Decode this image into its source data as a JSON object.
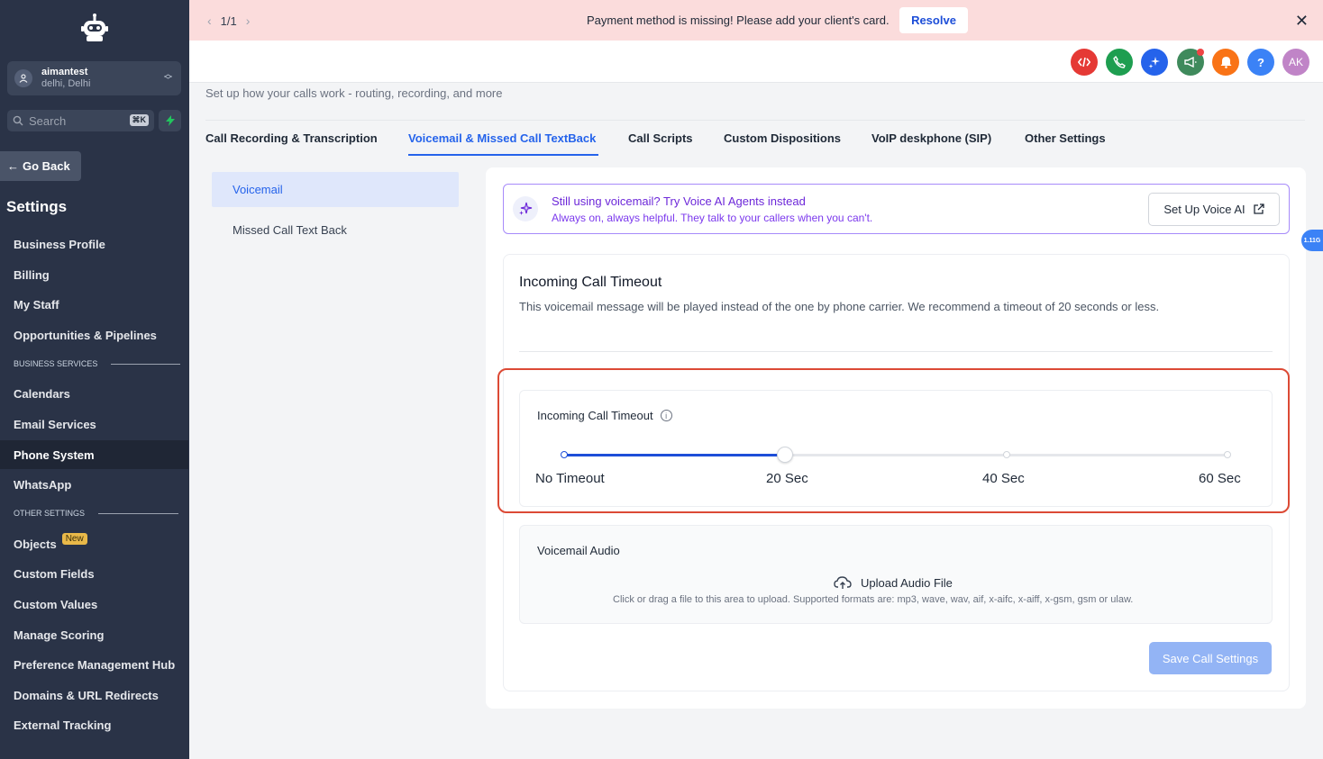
{
  "sidebar": {
    "account": {
      "name": "aimantest",
      "location": "delhi, Delhi"
    },
    "search": {
      "placeholder": "Search",
      "shortcut": "⌘K"
    },
    "go_back": "Go Back",
    "title": "Settings",
    "items": [
      {
        "label": "Business Profile"
      },
      {
        "label": "Billing"
      },
      {
        "label": "My Staff"
      },
      {
        "label": "Opportunities & Pipelines"
      },
      {
        "label": "Calendars"
      },
      {
        "label": "Email Services"
      },
      {
        "label": "Phone System",
        "active": true
      },
      {
        "label": "WhatsApp"
      },
      {
        "label": "Objects",
        "badge": "New"
      },
      {
        "label": "Custom Fields"
      },
      {
        "label": "Custom Values"
      },
      {
        "label": "Manage Scoring"
      },
      {
        "label": "Preference Management Hub"
      },
      {
        "label": "Domains & URL Redirects"
      },
      {
        "label": "External Tracking"
      }
    ],
    "sections": {
      "business": "BUSINESS SERVICES",
      "other": "OTHER SETTINGS"
    }
  },
  "banner": {
    "pager": "1/1",
    "message": "Payment method is missing! Please add your client's card.",
    "resolve": "Resolve"
  },
  "header": {
    "avatar_initials": "AK",
    "icons": [
      "code-icon",
      "phone-icon",
      "sparkle-icon",
      "megaphone-icon",
      "bell-icon",
      "help-icon"
    ],
    "colors": {
      "code": "#e53935",
      "phone": "#1e9e50",
      "sparkle": "#2563eb",
      "megaphone": "#3f8a5c",
      "bell": "#f97316",
      "help": "#3b82f6",
      "avatar": "#c084c7"
    }
  },
  "page": {
    "subtitle": "Set up how your calls work - routing, recording, and more",
    "tabs": [
      {
        "label": "Call Recording & Transcription"
      },
      {
        "label": "Voicemail & Missed Call TextBack",
        "active": true
      },
      {
        "label": "Call Scripts"
      },
      {
        "label": "Custom Dispositions"
      },
      {
        "label": "VoIP deskphone (SIP)"
      },
      {
        "label": "Other Settings"
      }
    ],
    "subnav": [
      {
        "label": "Voicemail",
        "active": true
      },
      {
        "label": "Missed Call Text Back"
      }
    ]
  },
  "promo": {
    "title": "Still using voicemail? Try Voice AI Agents instead",
    "subtitle": "Always on, always helpful. They talk to your callers when you can't.",
    "button": "Set Up Voice AI"
  },
  "version": "1.11G",
  "timeout": {
    "card_title": "Incoming Call Timeout",
    "card_desc": "This voicemail message will be played instead of the one by phone carrier. We recommend a timeout of 20 seconds or less.",
    "label": "Incoming Call Timeout",
    "marks": [
      "No Timeout",
      "20 Sec",
      "40 Sec",
      "60 Sec"
    ],
    "value_fraction": 0.3333
  },
  "audio": {
    "title": "Voicemail Audio",
    "upload": "Upload Audio File",
    "hint": "Click or drag a file to this area to upload. Supported formats are: mp3, wave, wav, aif, x-aifc, x-aiff, x-gsm, gsm or ulaw."
  },
  "save_button": "Save Call Settings"
}
